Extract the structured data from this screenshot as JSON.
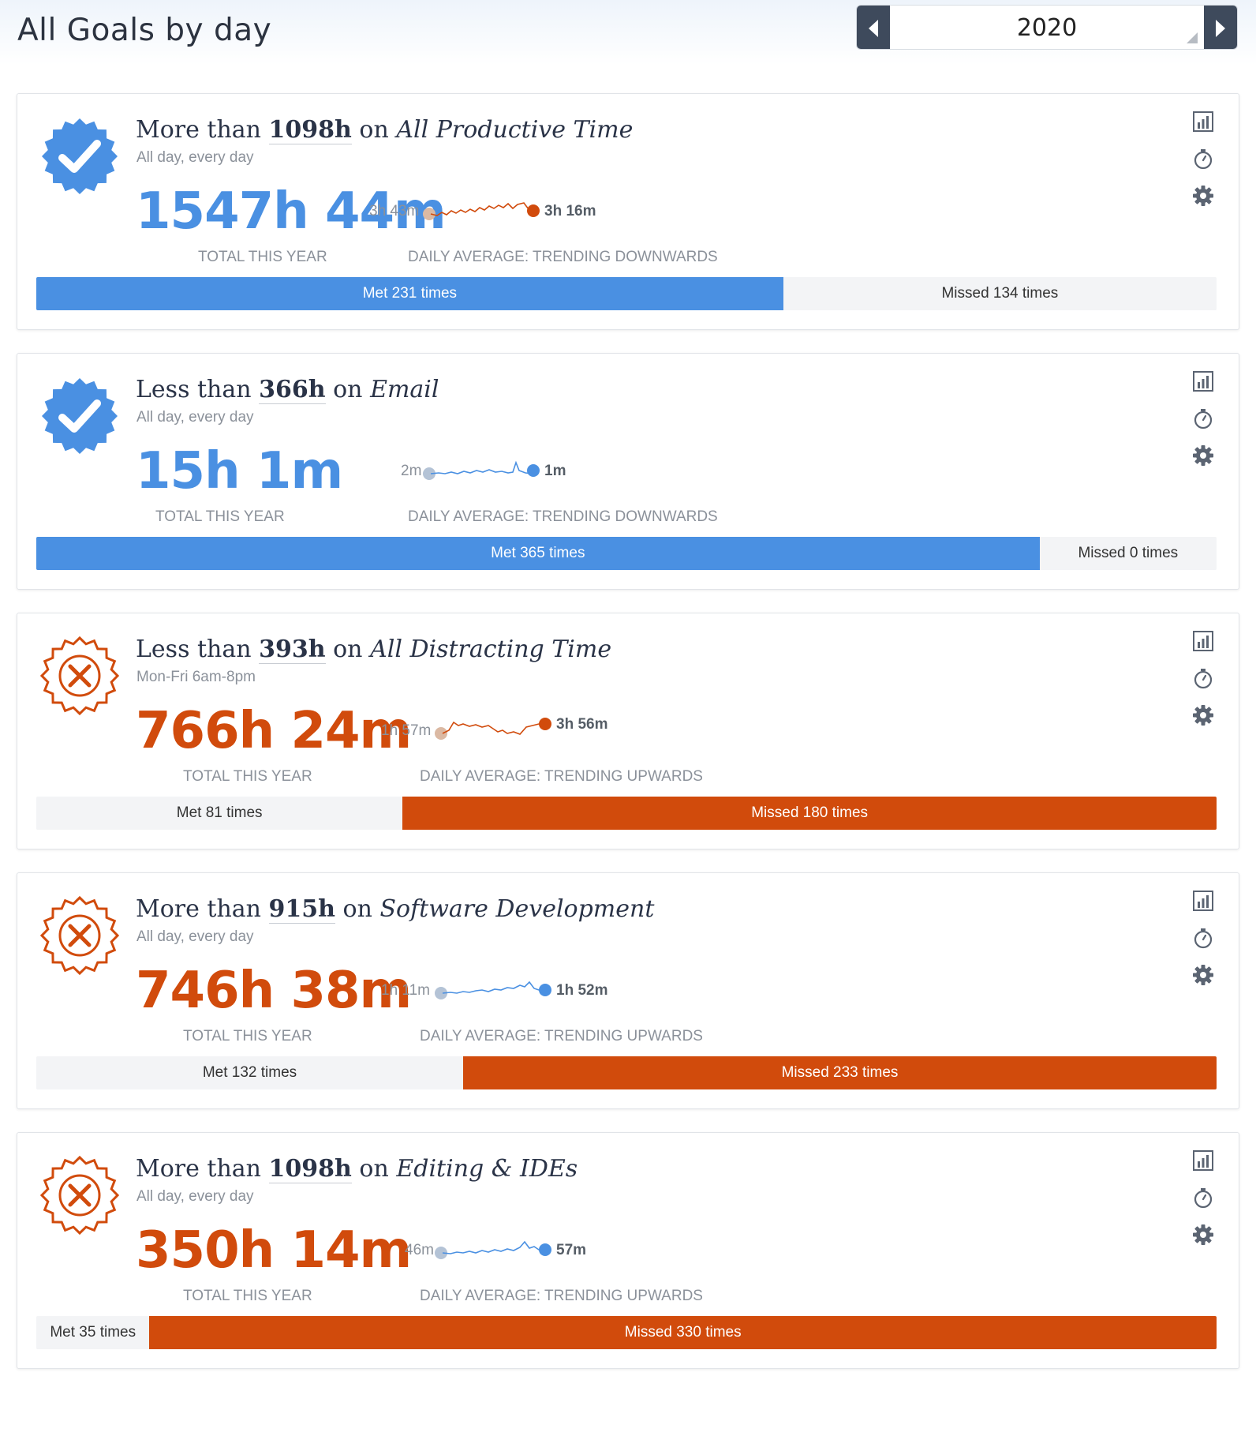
{
  "header": {
    "title": "All Goals by day",
    "year": "2020",
    "prev_icon": "triangle-left-icon",
    "next_icon": "triangle-right-icon"
  },
  "colors": {
    "met": "#4a90e2",
    "missed": "#d14b0c",
    "dark": "#3e4a5c",
    "muted": "#8b919a"
  },
  "labels": {
    "total": "TOTAL THIS YEAR"
  },
  "goals": [
    {
      "status": "met",
      "prefix": "More than",
      "target": "1098h",
      "on": "on",
      "category": "All Productive Time",
      "schedule": "All day, every day",
      "total": "1547h 44m",
      "trend_start": "3h 43m",
      "trend_end": "3h 16m",
      "trend_label": "DAILY AVERAGE: TRENDING DOWNWARDS",
      "met_label": "Met 231 times",
      "missed_label": "Missed 134 times",
      "met_count": 231,
      "missed_count": 134
    },
    {
      "status": "met",
      "prefix": "Less than",
      "target": "366h",
      "on": "on",
      "category": "Email",
      "schedule": "All day, every day",
      "total": "15h 1m",
      "trend_start": "2m",
      "trend_end": "1m",
      "trend_label": "DAILY AVERAGE: TRENDING DOWNWARDS",
      "met_label": "Met 365 times",
      "missed_label": "Missed 0 times",
      "met_count": 365,
      "missed_count": 0
    },
    {
      "status": "missed",
      "prefix": "Less than",
      "target": "393h",
      "on": "on",
      "category": "All Distracting Time",
      "schedule": "Mon-Fri 6am-8pm",
      "total": "766h 24m",
      "trend_start": "1h 57m",
      "trend_end": "3h 56m",
      "trend_label": "DAILY AVERAGE: TRENDING UPWARDS",
      "met_label": "Met 81 times",
      "missed_label": "Missed 180 times",
      "met_count": 81,
      "missed_count": 180
    },
    {
      "status": "missed",
      "prefix": "More than",
      "target": "915h",
      "on": "on",
      "category": "Software Development",
      "schedule": "All day, every day",
      "total": "746h 38m",
      "trend_start": "1h 11m",
      "trend_end": "1h 52m",
      "trend_label": "DAILY AVERAGE: TRENDING UPWARDS",
      "met_label": "Met 132 times",
      "missed_label": "Missed 233 times",
      "met_count": 132,
      "missed_count": 233
    },
    {
      "status": "missed",
      "prefix": "More than",
      "target": "1098h",
      "on": "on",
      "category": "Editing & IDEs",
      "schedule": "All day, every day",
      "total": "350h 14m",
      "trend_start": "46m",
      "trend_end": "57m",
      "trend_label": "DAILY AVERAGE: TRENDING UPWARDS",
      "met_label": "Met 35 times",
      "missed_label": "Missed 330 times",
      "met_count": 35,
      "missed_count": 330
    }
  ],
  "action_icons": [
    "bar-chart-icon",
    "stopwatch-icon",
    "gear-icon"
  ]
}
